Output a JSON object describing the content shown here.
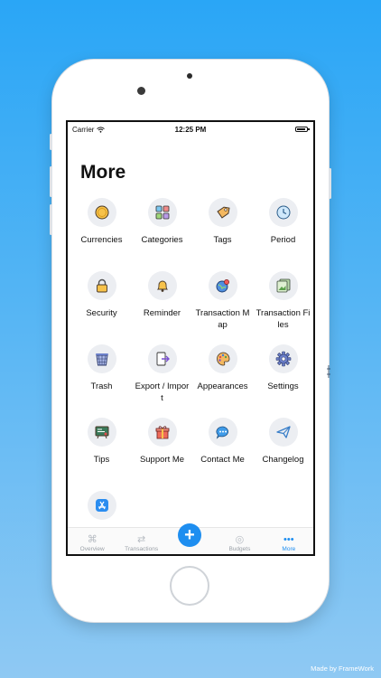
{
  "status_bar": {
    "carrier": "Carrier",
    "time": "12:25 PM",
    "battery_level": 0.9
  },
  "screen_title": "More",
  "menu": [
    {
      "label": "Currencies",
      "icon": "coin-icon"
    },
    {
      "label": "Categories",
      "icon": "categories-grid-icon"
    },
    {
      "label": "Tags",
      "icon": "tag-icon"
    },
    {
      "label": "Period",
      "icon": "clock-icon"
    },
    {
      "label": "Security",
      "icon": "lock-icon"
    },
    {
      "label": "Reminder",
      "icon": "bell-icon"
    },
    {
      "label": "Transaction Map",
      "icon": "globe-pin-icon"
    },
    {
      "label": "Transaction Files",
      "icon": "photo-files-icon"
    },
    {
      "label": "Trash",
      "icon": "trash-basket-icon"
    },
    {
      "label": "Export / Import",
      "icon": "export-import-icon"
    },
    {
      "label": "Appearances",
      "icon": "palette-icon"
    },
    {
      "label": "Settings",
      "icon": "gear-icon"
    },
    {
      "label": "Tips",
      "icon": "chalkboard-icon"
    },
    {
      "label": "Support Me",
      "icon": "gift-icon"
    },
    {
      "label": "Contact Me",
      "icon": "chat-bubble-icon"
    },
    {
      "label": "Changelog",
      "icon": "paper-plane-icon"
    },
    {
      "label": "",
      "icon": "app-store-icon"
    }
  ],
  "tabs": [
    {
      "label": "Overview",
      "icon": "overview-icon",
      "active": false
    },
    {
      "label": "Transactions",
      "icon": "transactions-icon",
      "active": false
    },
    {
      "label": "",
      "icon": "plus-icon",
      "active": false
    },
    {
      "label": "Budgets",
      "icon": "budgets-icon",
      "active": false
    },
    {
      "label": "More",
      "icon": "more-dots-icon",
      "active": true
    }
  ],
  "fab_symbol": "+",
  "credit": "Made by FrameWork",
  "colors": {
    "accent": "#1e8ef0",
    "background_top": "#2aa6f6",
    "background_bottom": "#8fc9f3"
  }
}
